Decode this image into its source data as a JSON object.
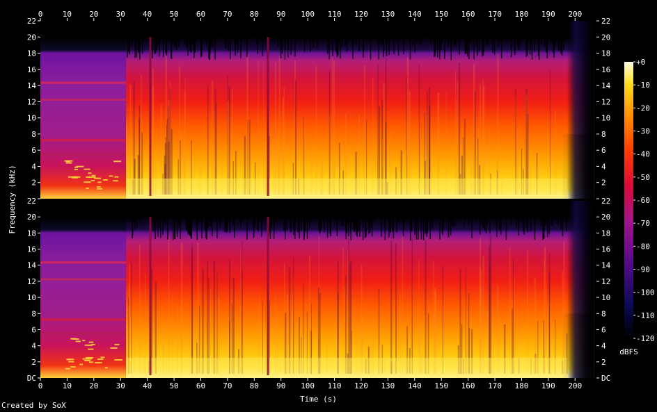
{
  "chart_data": {
    "type": "heatmap",
    "title": "",
    "xlabel": "Time (s)",
    "ylabel": "Frequency (kHz)",
    "xlim": [
      0,
      208
    ],
    "x_ticks": [
      "0",
      "10",
      "20",
      "30",
      "40",
      "50",
      "60",
      "70",
      "80",
      "90",
      "100",
      "110",
      "120",
      "130",
      "140",
      "150",
      "160",
      "170",
      "180",
      "190",
      "200"
    ],
    "ylim_khz": [
      0,
      22
    ],
    "y_ticks": [
      "DC",
      "2",
      "4",
      "6",
      "8",
      "10",
      "12",
      "14",
      "16",
      "18",
      "20",
      "22"
    ],
    "channels": 2,
    "colorbar": {
      "label": "dBFS",
      "range": [
        -120,
        0
      ],
      "ticks": [
        "+0",
        "-10",
        "-20",
        "-30",
        "-40",
        "-50",
        "-60",
        "-70",
        "-80",
        "-90",
        "-100",
        "-110",
        "-120"
      ]
    },
    "features": {
      "intro_end_s": 32,
      "intro_cutoff_khz": 20,
      "main_cutoff_khz": 20,
      "fade_start_s": 197,
      "fade_end_s": 207,
      "dropouts_s": [
        41,
        85
      ]
    },
    "footer": "Created by SoX"
  }
}
